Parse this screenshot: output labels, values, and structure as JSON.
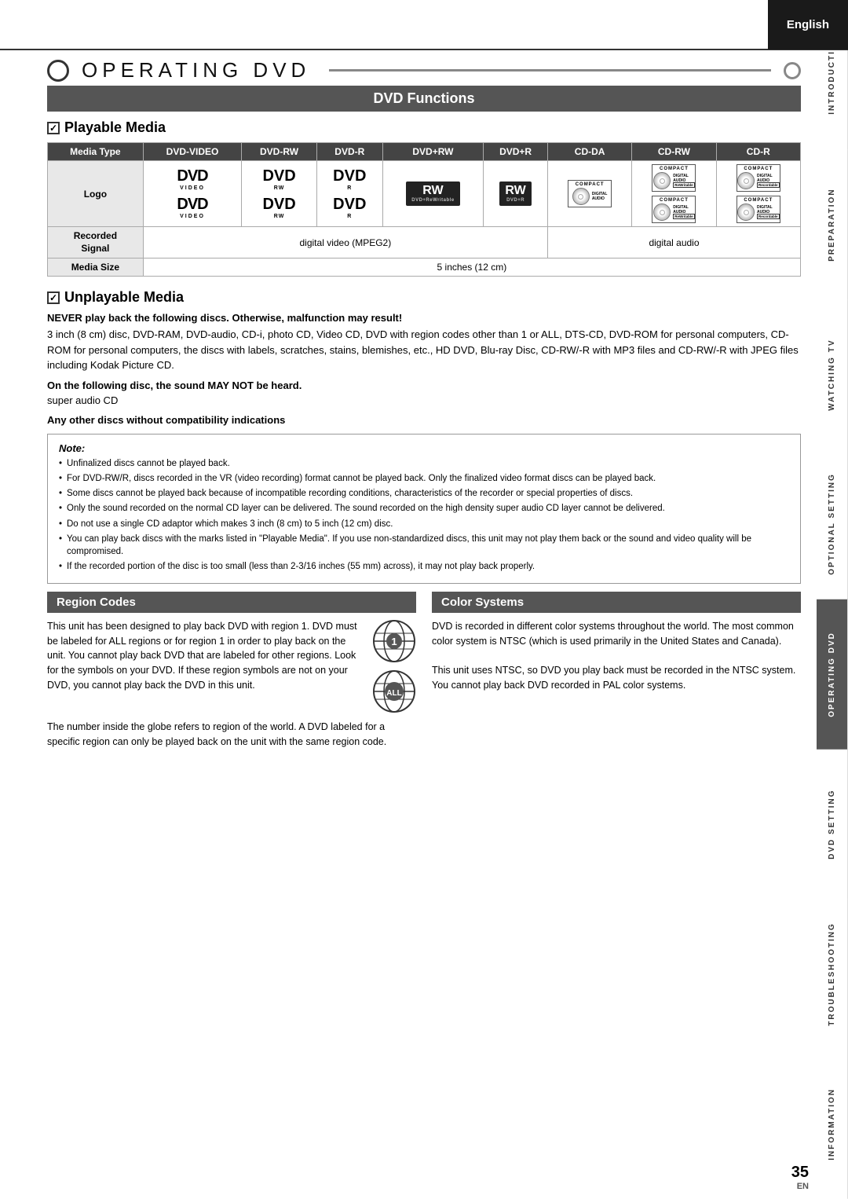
{
  "page": {
    "language": "English",
    "page_number": "35",
    "page_lang": "EN"
  },
  "header": {
    "title": "OPERATING   DVD",
    "section_title": "DVD Functions"
  },
  "sidebar": {
    "items": [
      {
        "label": "INTRODUCTION"
      },
      {
        "label": "PREPARATION"
      },
      {
        "label": "WATCHING TV"
      },
      {
        "label": "OPTIONAL SETTING"
      },
      {
        "label": "OPERATING DVD",
        "active": true
      },
      {
        "label": "DVD SETTING"
      },
      {
        "label": "TROUBLESHOOTING"
      },
      {
        "label": "INFORMATION"
      }
    ]
  },
  "playable_media": {
    "title": "Playable Media",
    "table": {
      "headers": [
        "Media Type",
        "DVD-VIDEO",
        "DVD-RW",
        "DVD-R",
        "DVD+RW",
        "DVD+R",
        "CD-DA",
        "CD-RW",
        "CD-R"
      ],
      "logo_row_label": "Logo",
      "recorded_signal_row_label": "Recorded\nSignal",
      "recorded_signal_dvd": "digital video (MPEG2)",
      "recorded_signal_cd": "digital audio",
      "media_size_row_label": "Media Size",
      "media_size_value": "5 inches (12 cm)"
    }
  },
  "unplayable_media": {
    "title": "Unplayable Media",
    "warning_bold": "NEVER play back the following discs. Otherwise, malfunction may result!",
    "warning_text": "3 inch (8 cm) disc, DVD-RAM, DVD-audio, CD-i, photo CD, Video CD, DVD with region codes other than 1 or ALL, DTS-CD, DVD-ROM for personal computers, CD-ROM for personal computers, the discs with labels, scratches, stains, blemishes, etc., HD DVD, Blu-ray Disc, CD-RW/-R with MP3 files and CD-RW/-R with JPEG files including Kodak Picture CD.",
    "sound_warning_bold": "On the following disc, the sound MAY NOT be heard.",
    "sound_warning_text": "super audio CD",
    "compat_bold": "Any other discs without compatibility indications",
    "note_title": "Note:",
    "notes": [
      "Unfinalized discs cannot be played back.",
      "For DVD-RW/R, discs recorded in the VR (video recording) format cannot be played back. Only the finalized video format discs can be played back.",
      "Some discs cannot be played back because of incompatible recording conditions, characteristics of the recorder or special properties of discs.",
      "Only the sound recorded on the normal CD layer can be delivered. The sound recorded on the high density super audio CD layer cannot be delivered.",
      "Do not use a single CD adaptor which makes 3 inch (8 cm) to 5 inch (12 cm) disc.",
      "You can play back discs with the marks listed in \"Playable Media\". If you use non-standardized discs, this unit may not play them back or the sound and video quality will be compromised.",
      "If the recorded portion of the disc is too small (less than 2-3/16 inches (55 mm) across), it may not play back properly."
    ]
  },
  "region_codes": {
    "title": "Region Codes",
    "body": "This unit has been designed to play back DVD with region 1. DVD must be labeled for ALL regions or for region 1 in order to play back on the unit. You cannot play back DVD that are labeled for other regions. Look for the symbols on your DVD. If these region symbols are not on your DVD, you cannot play back the DVD in this unit.",
    "footer": "The number inside the globe refers to region of the world. A DVD labeled for a specific region can only be played back on the unit with the same region code."
  },
  "color_systems": {
    "title": "Color Systems",
    "body": "DVD is recorded in different color systems throughout the world. The most common color system is NTSC (which is used primarily in the United States and Canada).\nThis unit uses NTSC, so DVD you play back must be recorded in the NTSC system. You cannot play back DVD recorded in PAL color systems."
  }
}
